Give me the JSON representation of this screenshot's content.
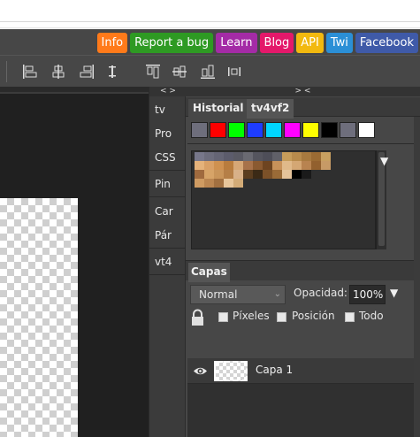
{
  "top_links": [
    {
      "label": "Info",
      "color": "#ff7a1a"
    },
    {
      "label": "Report a bug",
      "color": "#2e9a23"
    },
    {
      "label": "Learn",
      "color": "#a42ba6"
    },
    {
      "label": "Blog",
      "color": "#e4186a"
    },
    {
      "label": "API",
      "color": "#f2b90f"
    },
    {
      "label": "Twi",
      "color": "#2b8fd6"
    },
    {
      "label": "Facebook",
      "color": "#3f5aa8"
    }
  ],
  "panel_headers": {
    "mid": "< >",
    "right": "> <"
  },
  "mid_panel": {
    "groups": [
      [
        "tv",
        "Pro",
        "CSS"
      ],
      [
        "Pin"
      ],
      [
        "Car",
        "Pár"
      ],
      [
        "vt4"
      ]
    ]
  },
  "colors_panel": {
    "tabs": [
      "Historial",
      "tv4vf2"
    ],
    "swatches": [
      "#6e6e7c",
      "#ff0000",
      "#00ff00",
      "#1e3cff",
      "#00d6ff",
      "#ff00ff",
      "#ffff00",
      "#000000",
      "#6e6e7c",
      "#ffffff"
    ],
    "palette_arrow": "▼"
  },
  "layers_panel": {
    "tab": "Capas",
    "blend_mode": "Normal",
    "opacity_label": "Opacidad:",
    "opacity_value": "100%",
    "opacity_arrow": "▼",
    "lock_options": [
      "Píxeles",
      "Posición",
      "Todo"
    ],
    "layers": [
      {
        "name": "Capa 1",
        "visible": true
      }
    ]
  }
}
